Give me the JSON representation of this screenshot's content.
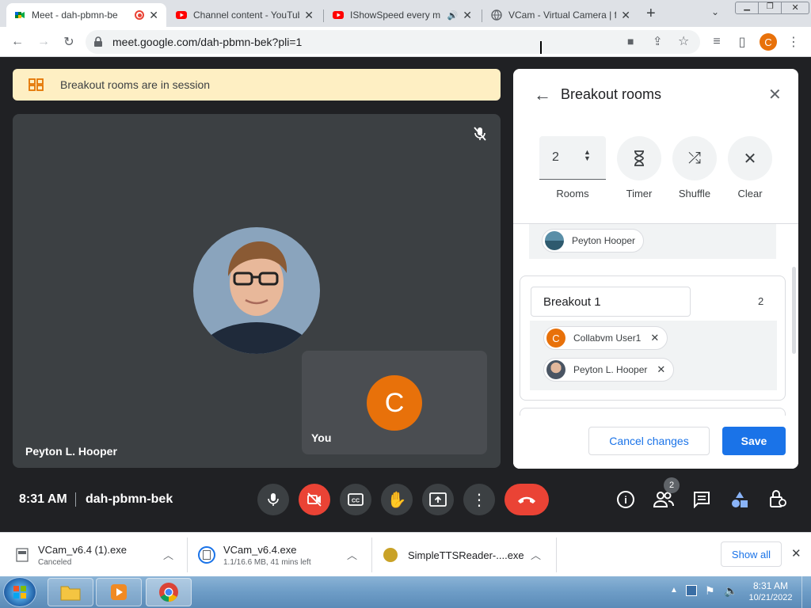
{
  "browser": {
    "tabs": [
      {
        "title": "Meet - dah-pbmn-be",
        "active": true
      },
      {
        "title": "Channel content - YouTub",
        "active": false
      },
      {
        "title": "IShowSpeed every m",
        "active": false
      },
      {
        "title": "VCam - Virtual Camera | f",
        "active": false
      }
    ],
    "url": "meet.google.com/dah-pbmn-bek?pli=1",
    "profile_initial": "C"
  },
  "meet": {
    "banner_text": "Breakout rooms are in session",
    "main_participant": "Peyton L. Hooper",
    "self_label": "You",
    "self_initial": "C",
    "time": "8:31 AM",
    "meeting_code": "dah-pbmn-bek",
    "people_count": "2"
  },
  "breakout": {
    "title": "Breakout rooms",
    "room_count": "2",
    "labels": {
      "rooms": "Rooms",
      "timer": "Timer",
      "shuffle": "Shuffle",
      "clear": "Clear"
    },
    "unassigned": [
      {
        "name": "Peyton Hooper"
      }
    ],
    "rooms": [
      {
        "name": "Breakout 1",
        "count": "2",
        "members": [
          {
            "name": "Collabvm User1",
            "initial": "C"
          },
          {
            "name": "Peyton L. Hooper"
          }
        ]
      }
    ],
    "cancel_label": "Cancel changes",
    "save_label": "Save"
  },
  "downloads": {
    "items": [
      {
        "name": "VCam_v6.4 (1).exe",
        "status": "Canceled"
      },
      {
        "name": "VCam_v6.4.exe",
        "status": "1.1/16.6 MB, 41 mins left"
      },
      {
        "name": "SimpleTTSReader-....exe",
        "status": ""
      }
    ],
    "show_all": "Show all"
  },
  "taskbar": {
    "time": "8:31 AM",
    "date": "10/21/2022"
  },
  "colors": {
    "meet_bg": "#202124",
    "accent_blue": "#1a73e8",
    "red": "#ea4335",
    "avatar_orange": "#e8710a",
    "banner": "#feefc3"
  }
}
